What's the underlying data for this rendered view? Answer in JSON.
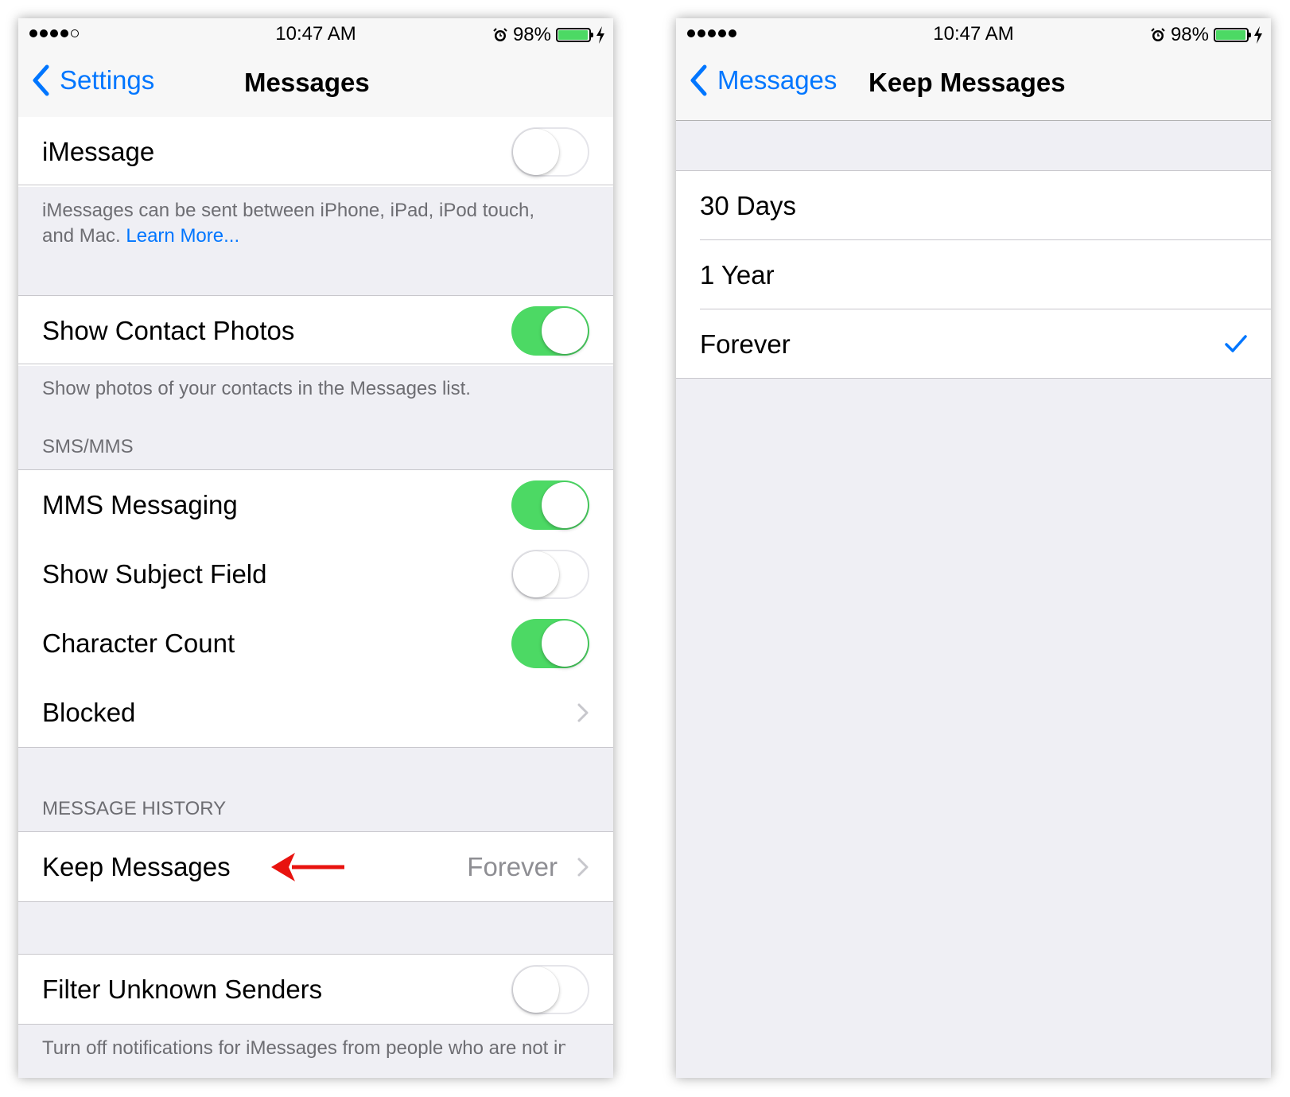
{
  "status_bar": {
    "time": "10:47 AM",
    "battery_percent_text": "98%",
    "battery_level": 0.98
  },
  "left": {
    "signal_dots_filled": 4,
    "nav": {
      "back_label": "Settings",
      "title": "Messages"
    },
    "imessage": {
      "label": "iMessage",
      "toggle_on": false
    },
    "imessage_footer": {
      "text": "iMessages can be sent between iPhone, iPad, iPod touch, and Mac.",
      "link": "Learn More..."
    },
    "contact_photos": {
      "label": "Show Contact Photos",
      "toggle_on": true
    },
    "contact_photos_footer": "Show photos of your contacts in the Messages list.",
    "sms_header": "SMS/MMS",
    "mms": {
      "label": "MMS Messaging",
      "toggle_on": true
    },
    "subject": {
      "label": "Show Subject Field",
      "toggle_on": false
    },
    "char_count": {
      "label": "Character Count",
      "toggle_on": true
    },
    "blocked": {
      "label": "Blocked"
    },
    "history_header": "MESSAGE HISTORY",
    "keep_messages": {
      "label": "Keep Messages",
      "value": "Forever"
    },
    "filter": {
      "label": "Filter Unknown Senders",
      "toggle_on": false
    },
    "filter_footer": "Turn off notifications for iMessages from people who are not in your contacts."
  },
  "right": {
    "signal_dots_filled": 5,
    "nav": {
      "back_label": "Messages",
      "title": "Keep Messages"
    },
    "options": [
      {
        "label": "30 Days",
        "selected": false
      },
      {
        "label": "1 Year",
        "selected": false
      },
      {
        "label": "Forever",
        "selected": true
      }
    ]
  },
  "colors": {
    "accent_blue": "#0076ff",
    "toggle_green": "#4cd964",
    "annotation_red": "#e8130f",
    "background_gray": "#efeff4"
  },
  "icons": [
    "chevron-left-icon",
    "chevron-right-icon",
    "alarm-icon",
    "battery-icon",
    "bolt-icon",
    "checkmark-icon",
    "red-arrow-icon"
  ]
}
